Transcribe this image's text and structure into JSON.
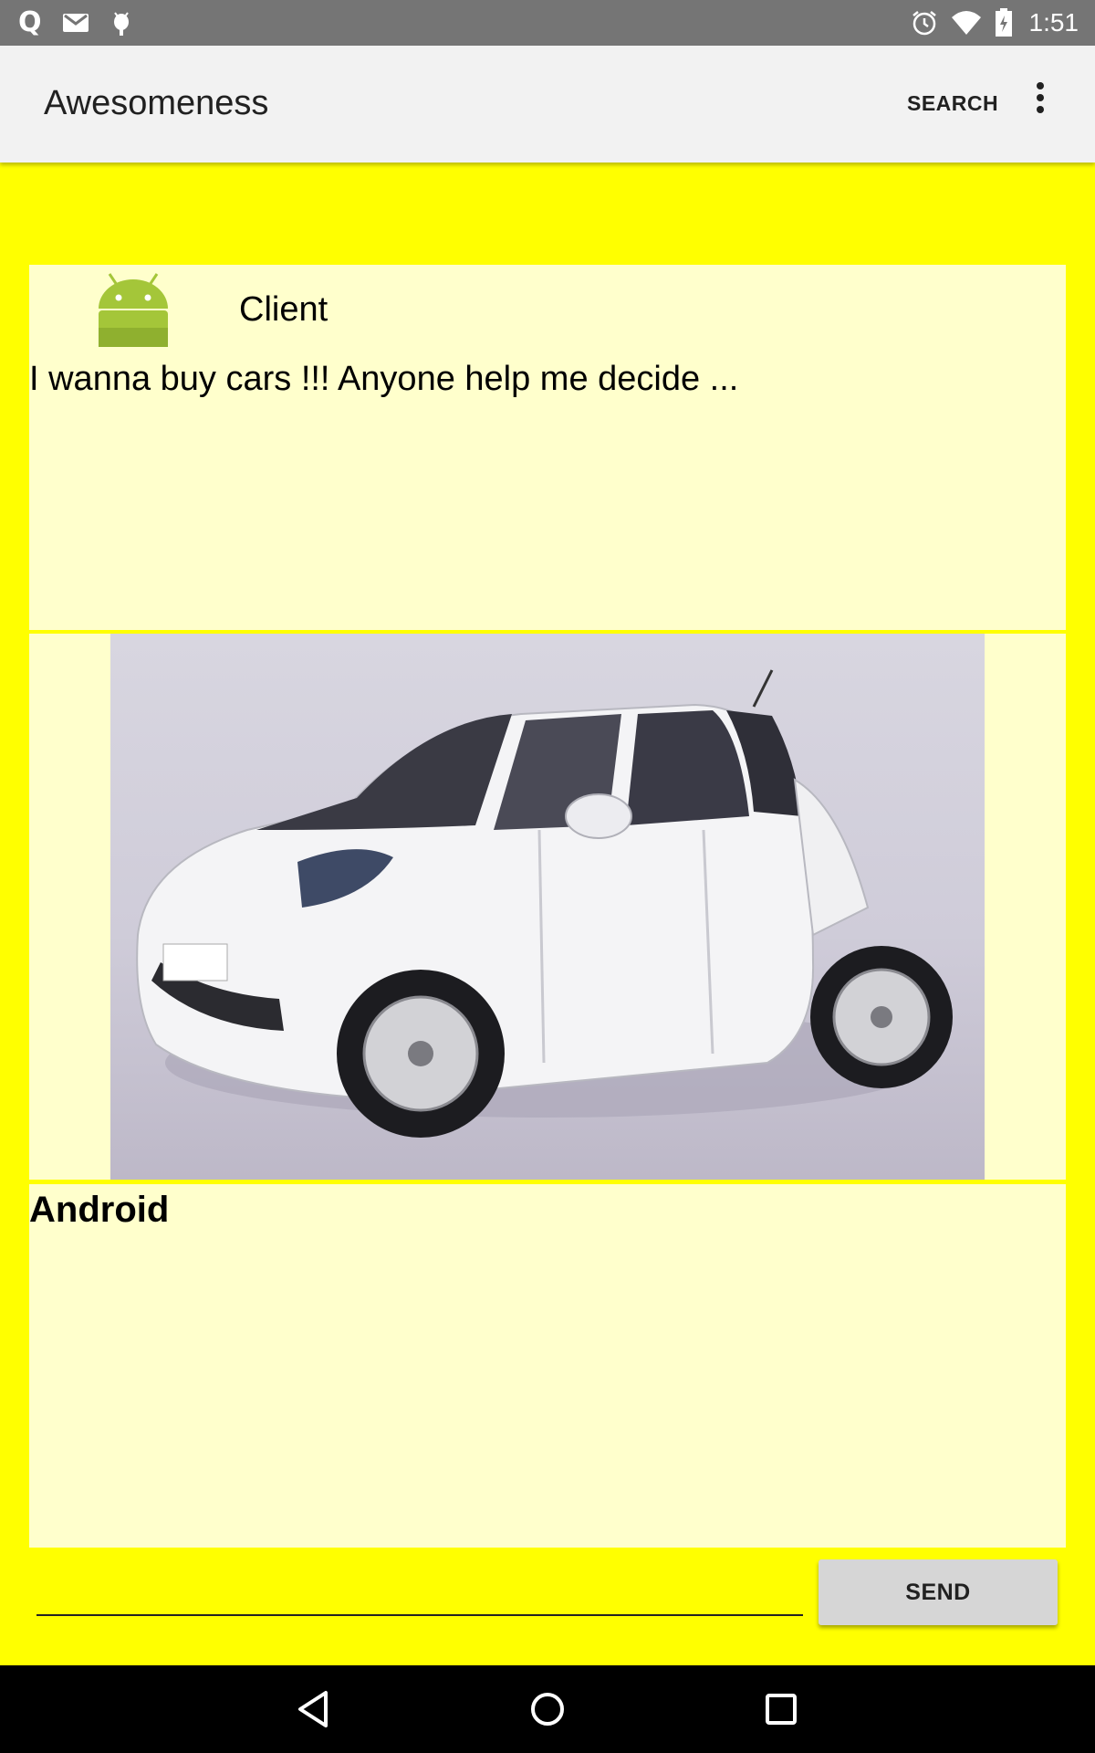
{
  "status_bar": {
    "left_icons": [
      "q-app-icon",
      "gmail-icon",
      "debug-icon"
    ],
    "app_letter": "Q",
    "time": "1:51",
    "right_icons": [
      "alarm-icon",
      "wifi-icon",
      "battery-icon"
    ]
  },
  "app_bar": {
    "title": "Awesomeness",
    "search_label": "SEARCH",
    "overflow_icon": "more-vert-icon"
  },
  "post": {
    "author": "Client",
    "avatar_icon": "android-avatar-icon",
    "message": "I wanna buy cars !!! Anyone help me decide ..."
  },
  "attachment": {
    "kind": "photo of a white compact car"
  },
  "reply": {
    "author": "Android"
  },
  "composer": {
    "input_value": "",
    "input_placeholder": "",
    "send_label": "SEND"
  },
  "nav_bar": {
    "icons": [
      "back-icon",
      "home-icon",
      "recents-icon"
    ]
  },
  "colors": {
    "background": "#ffff00",
    "card": "#ffffcc",
    "app_bar": "#f2f2f2",
    "status_bar": "#757575",
    "android_green": "#a4c639"
  }
}
